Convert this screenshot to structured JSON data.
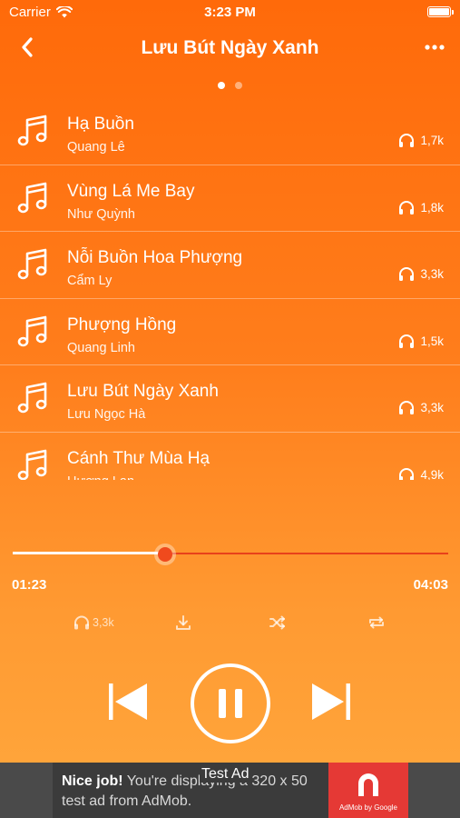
{
  "status_bar": {
    "carrier": "Carrier",
    "time": "3:23 PM"
  },
  "header": {
    "title": "Lưu Bút Ngày Xanh"
  },
  "page_indicator": {
    "count": 2,
    "active": 1
  },
  "songs": [
    {
      "title": "Hạ Buồn",
      "artist": "Quang Lê",
      "plays": "1,7k"
    },
    {
      "title": "Vùng Lá Me Bay",
      "artist": "Như Quỳnh",
      "plays": "1,8k"
    },
    {
      "title": "Nỗi Buồn Hoa Phượng",
      "artist": "Cẩm Ly",
      "plays": "3,3k"
    },
    {
      "title": "Phượng Hồng",
      "artist": "Quang Linh",
      "plays": "1,5k"
    },
    {
      "title": "Lưu Bút Ngày Xanh",
      "artist": "Lưu Ngọc Hà",
      "plays": "3,3k"
    },
    {
      "title": "Cánh Thư Mùa Hạ",
      "artist": "Hương Lan",
      "plays": "4,9k"
    }
  ],
  "player": {
    "current_time": "01:23",
    "total_time": "04:03",
    "progress_fraction": 0.35,
    "listen_count": "3,3k"
  },
  "ad": {
    "headline": "Nice job!",
    "body": " You're displaying a 320 x 50 test ad from AdMob.",
    "tag": "Test Ad",
    "logo_label": "AdMob by Google"
  },
  "colors": {
    "gradient_top": "#ff6a0a",
    "gradient_bottom": "#ffa83d",
    "progress_remaining": "#e8411a",
    "ad_logo": "#e53935"
  },
  "icons": {
    "back": "chevron-left-icon",
    "more": "ellipsis-icon",
    "song": "music-note-icon",
    "plays": "headphone-icon",
    "download": "download-icon",
    "shuffle": "shuffle-icon",
    "repeat": "repeat-icon",
    "previous": "skip-previous-icon",
    "pause": "pause-icon",
    "next": "skip-next-icon"
  }
}
